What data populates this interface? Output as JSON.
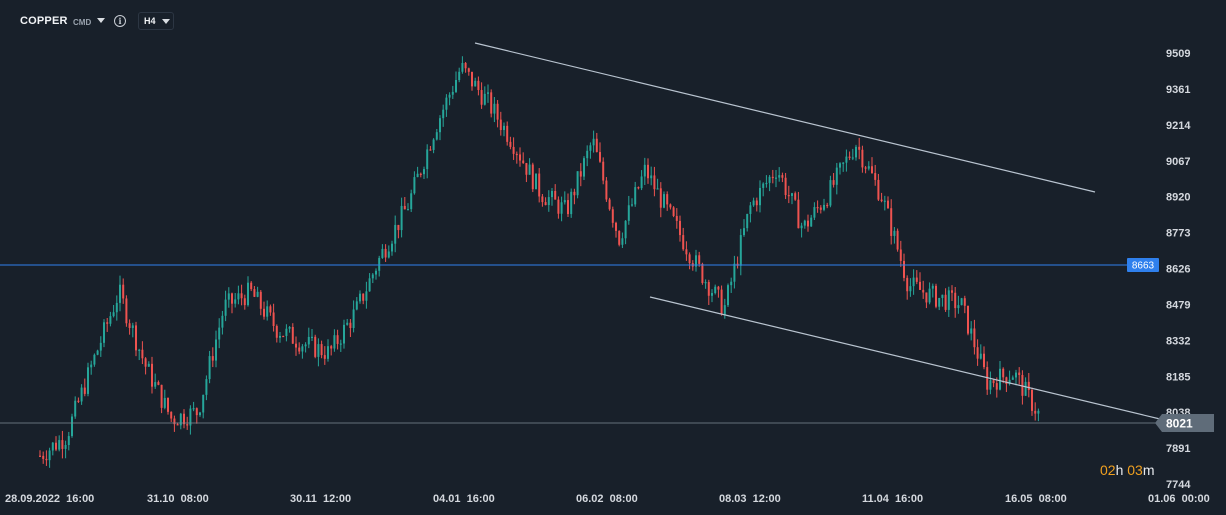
{
  "toolbar": {
    "symbol": "COPPER",
    "instrument_type": "CMD",
    "symbol_dropdown_icon": "caret-down-icon",
    "info_icon": "info-icon",
    "info_glyph": "i",
    "timeframe": "H4"
  },
  "price_axis": {
    "ticks": [
      "9509",
      "9361",
      "9214",
      "9067",
      "8920",
      "8773",
      "8626",
      "8479",
      "8332",
      "8185",
      "8038",
      "7891",
      "7744"
    ]
  },
  "time_axis": {
    "ticks": [
      "28.09.2022  16:00",
      "31.10  08:00",
      "30.11  12:00",
      "04.01  16:00",
      "06.02  08:00",
      "08.03  12:00",
      "11.04  16:00",
      "16.05  08:00",
      "01.06  00:00"
    ]
  },
  "horizontal_level": {
    "label": "8663",
    "color": "#2f80ed"
  },
  "current_price": {
    "label": "8021",
    "color": "#5f6c79"
  },
  "countdown": {
    "hours": "02",
    "h_unit": "h",
    "minutes": "03",
    "m_unit": "m"
  },
  "colors": {
    "background": "#18202a",
    "bullish": "#26a69a",
    "bearish": "#ef5350",
    "trendline": "#b9c4d0"
  },
  "chart_data": {
    "type": "candlestick",
    "symbol": "COPPER",
    "timeframe": "H4",
    "ylim": [
      7744,
      9580
    ],
    "x": [
      "28.09.2022",
      "31.10",
      "30.11",
      "04.01",
      "06.02",
      "08.03",
      "11.04",
      "16.05",
      "01.06"
    ],
    "series": [
      {
        "name": "",
        "points": [
          {
            "x": "28.09.2022",
            "y": 7860
          },
          {
            "x": "25.10",
            "y": 7940
          },
          {
            "x": "31.10",
            "y": 8240
          },
          {
            "x": "04.11",
            "y": 8530
          },
          {
            "x": "10.11",
            "y": 8230
          },
          {
            "x": "16.11",
            "y": 8010
          },
          {
            "x": "23.11",
            "y": 8040
          },
          {
            "x": "30.11",
            "y": 8470
          },
          {
            "x": "05.12",
            "y": 8530
          },
          {
            "x": "12.12",
            "y": 8380
          },
          {
            "x": "19.12",
            "y": 8320
          },
          {
            "x": "28.12",
            "y": 8280
          },
          {
            "x": "02.01",
            "y": 8450
          },
          {
            "x": "04.01",
            "y": 8690
          },
          {
            "x": "06.01",
            "y": 8890
          },
          {
            "x": "12.01",
            "y": 9200
          },
          {
            "x": "18.01",
            "y": 9450
          },
          {
            "x": "25.01",
            "y": 9310
          },
          {
            "x": "01.02",
            "y": 9140
          },
          {
            "x": "06.02",
            "y": 8940
          },
          {
            "x": "13.02",
            "y": 8860
          },
          {
            "x": "20.02",
            "y": 9150
          },
          {
            "x": "27.02",
            "y": 8750
          },
          {
            "x": "03.03",
            "y": 9030
          },
          {
            "x": "08.03",
            "y": 8830
          },
          {
            "x": "13.03",
            "y": 8630
          },
          {
            "x": "20.03",
            "y": 8460
          },
          {
            "x": "27.03",
            "y": 8880
          },
          {
            "x": "03.04",
            "y": 9040
          },
          {
            "x": "06.04",
            "y": 8790
          },
          {
            "x": "11.04",
            "y": 8940
          },
          {
            "x": "14.04",
            "y": 9140
          },
          {
            "x": "20.04",
            "y": 8920
          },
          {
            "x": "27.04",
            "y": 8560
          },
          {
            "x": "04.05",
            "y": 8510
          },
          {
            "x": "10.05",
            "y": 8480
          },
          {
            "x": "16.05",
            "y": 8160
          },
          {
            "x": "20.05",
            "y": 8200
          },
          {
            "x": "24.05",
            "y": 8021
          }
        ]
      }
    ],
    "trendlines": [
      {
        "from": {
          "x": "16.01",
          "y": 9545
        },
        "to": {
          "x": "01.06",
          "y": 8960
        }
      },
      {
        "from": {
          "x": "01.03",
          "y": 8530
        },
        "to": {
          "x": "01.06",
          "y": 8030
        }
      }
    ],
    "horizontal_lines": [
      8663,
      8021
    ]
  }
}
